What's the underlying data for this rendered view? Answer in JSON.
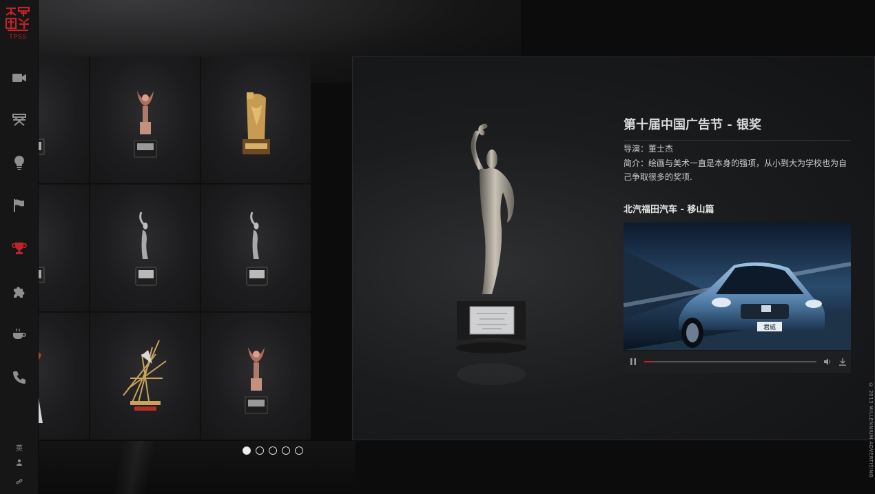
{
  "brand": {
    "logo_text": "TPSS",
    "accent": "#c0232a"
  },
  "sidebar": {
    "items": [
      {
        "icon": "video-camera-icon"
      },
      {
        "icon": "director-chair-icon"
      },
      {
        "icon": "lightbulb-icon"
      },
      {
        "icon": "flag-icon"
      },
      {
        "icon": "trophy-icon",
        "active": true
      },
      {
        "icon": "puzzle-icon"
      },
      {
        "icon": "coffee-cup-icon"
      },
      {
        "icon": "phone-icon"
      }
    ],
    "lang_label": "英"
  },
  "gallery": {
    "pages": 5,
    "current_page": 1
  },
  "detail": {
    "title": "第十届中国广告节 - 银奖",
    "director": "导演：董士杰",
    "summary": "简介：绘画与美术一直是本身的强项，从小到大为学校也为自己争取很多的奖项.",
    "work_title": "北汽福田汽车 - 移山篇",
    "video": {
      "car_plate": "君威",
      "progress": 0.05
    }
  },
  "copyright": "© 2013 MILLENNIUM ADVERTISING"
}
